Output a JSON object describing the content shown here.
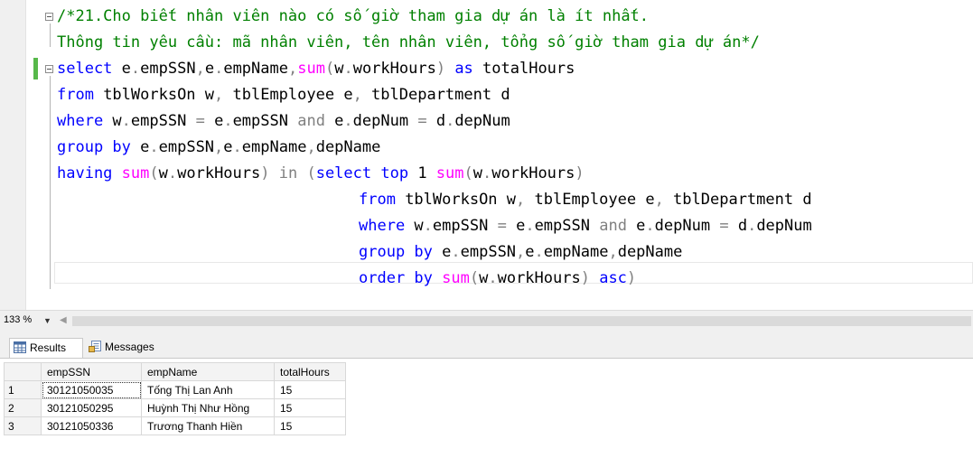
{
  "editor": {
    "lines": [
      {
        "tokens": [
          {
            "t": "/*21.Cho biết nhân viên nào có số giờ tham gia dự án là ít nhất.",
            "c": "cm"
          }
        ]
      },
      {
        "tokens": [
          {
            "t": "Thông tin yêu cầu: mã nhân viên, tên nhân viên, tổng số giờ tham gia dự án*/",
            "c": "cm"
          }
        ]
      },
      {
        "tokens": [
          {
            "t": "select",
            "c": "kw"
          },
          {
            "t": " e",
            "c": "tx"
          },
          {
            "t": ".",
            "c": "op"
          },
          {
            "t": "empSSN",
            "c": "tx"
          },
          {
            "t": ",",
            "c": "op"
          },
          {
            "t": "e",
            "c": "tx"
          },
          {
            "t": ".",
            "c": "op"
          },
          {
            "t": "empName",
            "c": "tx"
          },
          {
            "t": ",",
            "c": "op"
          },
          {
            "t": "sum",
            "c": "fn"
          },
          {
            "t": "(",
            "c": "op"
          },
          {
            "t": "w",
            "c": "tx"
          },
          {
            "t": ".",
            "c": "op"
          },
          {
            "t": "workHours",
            "c": "tx"
          },
          {
            "t": ")",
            "c": "op"
          },
          {
            "t": " as",
            "c": "kw"
          },
          {
            "t": " totalHours",
            "c": "tx"
          }
        ]
      },
      {
        "tokens": [
          {
            "t": "from",
            "c": "kw"
          },
          {
            "t": " tblWorksOn w",
            "c": "tx"
          },
          {
            "t": ",",
            "c": "op"
          },
          {
            "t": " tblEmployee e",
            "c": "tx"
          },
          {
            "t": ",",
            "c": "op"
          },
          {
            "t": " tblDepartment d",
            "c": "tx"
          }
        ]
      },
      {
        "tokens": [
          {
            "t": "where",
            "c": "kw"
          },
          {
            "t": " w",
            "c": "tx"
          },
          {
            "t": ".",
            "c": "op"
          },
          {
            "t": "empSSN ",
            "c": "tx"
          },
          {
            "t": "=",
            "c": "op"
          },
          {
            "t": " e",
            "c": "tx"
          },
          {
            "t": ".",
            "c": "op"
          },
          {
            "t": "empSSN ",
            "c": "tx"
          },
          {
            "t": "and",
            "c": "op"
          },
          {
            "t": " e",
            "c": "tx"
          },
          {
            "t": ".",
            "c": "op"
          },
          {
            "t": "depNum ",
            "c": "tx"
          },
          {
            "t": "=",
            "c": "op"
          },
          {
            "t": " d",
            "c": "tx"
          },
          {
            "t": ".",
            "c": "op"
          },
          {
            "t": "depNum",
            "c": "tx"
          }
        ]
      },
      {
        "tokens": [
          {
            "t": "group by",
            "c": "kw"
          },
          {
            "t": " e",
            "c": "tx"
          },
          {
            "t": ".",
            "c": "op"
          },
          {
            "t": "empSSN",
            "c": "tx"
          },
          {
            "t": ",",
            "c": "op"
          },
          {
            "t": "e",
            "c": "tx"
          },
          {
            "t": ".",
            "c": "op"
          },
          {
            "t": "empName",
            "c": "tx"
          },
          {
            "t": ",",
            "c": "op"
          },
          {
            "t": "depName",
            "c": "tx"
          }
        ]
      },
      {
        "tokens": [
          {
            "t": "having",
            "c": "kw"
          },
          {
            "t": " sum",
            "c": "fn"
          },
          {
            "t": "(",
            "c": "op"
          },
          {
            "t": "w",
            "c": "tx"
          },
          {
            "t": ".",
            "c": "op"
          },
          {
            "t": "workHours",
            "c": "tx"
          },
          {
            "t": ")",
            "c": "op"
          },
          {
            "t": " in",
            "c": "op"
          },
          {
            "t": " (",
            "c": "op"
          },
          {
            "t": "select",
            "c": "kw"
          },
          {
            "t": " top",
            "c": "kw"
          },
          {
            "t": " 1 ",
            "c": "tx"
          },
          {
            "t": "sum",
            "c": "fn"
          },
          {
            "t": "(",
            "c": "op"
          },
          {
            "t": "w",
            "c": "tx"
          },
          {
            "t": ".",
            "c": "op"
          },
          {
            "t": "workHours",
            "c": "tx"
          },
          {
            "t": ")",
            "c": "op"
          }
        ]
      },
      {
        "indent": true,
        "tokens": [
          {
            "t": "from",
            "c": "kw"
          },
          {
            "t": " tblWorksOn w",
            "c": "tx"
          },
          {
            "t": ",",
            "c": "op"
          },
          {
            "t": " tblEmployee e",
            "c": "tx"
          },
          {
            "t": ",",
            "c": "op"
          },
          {
            "t": " tblDepartment d",
            "c": "tx"
          }
        ]
      },
      {
        "indent": true,
        "tokens": [
          {
            "t": "where",
            "c": "kw"
          },
          {
            "t": " w",
            "c": "tx"
          },
          {
            "t": ".",
            "c": "op"
          },
          {
            "t": "empSSN ",
            "c": "tx"
          },
          {
            "t": "=",
            "c": "op"
          },
          {
            "t": " e",
            "c": "tx"
          },
          {
            "t": ".",
            "c": "op"
          },
          {
            "t": "empSSN ",
            "c": "tx"
          },
          {
            "t": "and",
            "c": "op"
          },
          {
            "t": " e",
            "c": "tx"
          },
          {
            "t": ".",
            "c": "op"
          },
          {
            "t": "depNum ",
            "c": "tx"
          },
          {
            "t": "=",
            "c": "op"
          },
          {
            "t": " d",
            "c": "tx"
          },
          {
            "t": ".",
            "c": "op"
          },
          {
            "t": "depNum",
            "c": "tx"
          }
        ]
      },
      {
        "indent": true,
        "tokens": [
          {
            "t": "group by",
            "c": "kw"
          },
          {
            "t": " e",
            "c": "tx"
          },
          {
            "t": ".",
            "c": "op"
          },
          {
            "t": "empSSN",
            "c": "tx"
          },
          {
            "t": ",",
            "c": "op"
          },
          {
            "t": "e",
            "c": "tx"
          },
          {
            "t": ".",
            "c": "op"
          },
          {
            "t": "empName",
            "c": "tx"
          },
          {
            "t": ",",
            "c": "op"
          },
          {
            "t": "depName",
            "c": "tx"
          }
        ]
      },
      {
        "indent": true,
        "tokens": [
          {
            "t": "order by",
            "c": "kw"
          },
          {
            "t": " sum",
            "c": "fn"
          },
          {
            "t": "(",
            "c": "op"
          },
          {
            "t": "w",
            "c": "tx"
          },
          {
            "t": ".",
            "c": "op"
          },
          {
            "t": "workHours",
            "c": "tx"
          },
          {
            "t": ")",
            "c": "op"
          },
          {
            "t": " asc",
            "c": "kw"
          },
          {
            "t": ")",
            "c": "op"
          }
        ]
      }
    ]
  },
  "status": {
    "zoom": "133 %"
  },
  "tabs": {
    "results": "Results",
    "messages": "Messages"
  },
  "grid": {
    "columns": [
      "empSSN",
      "empName",
      "totalHours"
    ],
    "rows": [
      {
        "num": "1",
        "cells": [
          "30121050035",
          "Tống Thị Lan Anh",
          "15"
        ]
      },
      {
        "num": "2",
        "cells": [
          "30121050295",
          "Huỳnh Thị Như Hồng",
          "15"
        ]
      },
      {
        "num": "3",
        "cells": [
          "30121050336",
          "Trương Thanh Hiền",
          "15"
        ]
      }
    ]
  },
  "colors": {
    "keyword": "#0000ff",
    "function": "#ff00ff",
    "operator": "#808080",
    "comment": "#008000",
    "change_bar": "#57b84a"
  },
  "icons": {
    "results_tab": "grid-icon",
    "messages_tab": "messages-icon",
    "fold": "collapse-box-icon"
  }
}
